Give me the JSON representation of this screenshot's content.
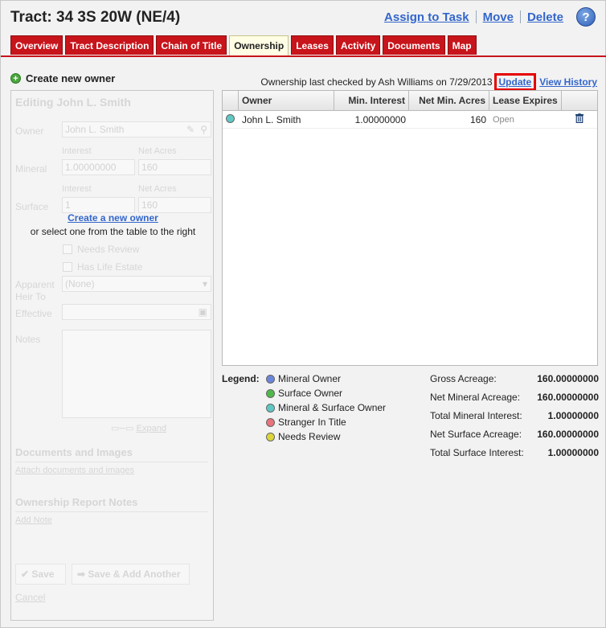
{
  "header": {
    "title": "Tract: 34 3S 20W (NE/4)",
    "links": [
      "Assign to Task",
      "Move",
      "Delete"
    ],
    "help_label": "?"
  },
  "tabs": [
    "Overview",
    "Tract Description",
    "Chain of Title",
    "Ownership",
    "Leases",
    "Activity",
    "Documents",
    "Map"
  ],
  "active_tab": "Ownership",
  "create_owner_label": "Create new owner",
  "editor": {
    "heading": "Editing John L. Smith",
    "owner_label": "Owner",
    "owner_value": "John L. Smith",
    "interest_header": "Interest",
    "net_acres_header": "Net Acres",
    "mineral_label": "Mineral",
    "mineral_interest": "1.00000000",
    "mineral_acres": "160",
    "surface_label": "Surface",
    "surface_interest": "1",
    "surface_acres": "160",
    "create_link": "Create a new owner",
    "select_hint": "or select one from the table to the right",
    "needs_review": "Needs Review",
    "has_life_estate": "Has Life Estate",
    "heir_label_1": "Apparent",
    "heir_label_2": "Heir To",
    "heir_value": "(None)",
    "effective_label": "Effective",
    "notes_label": "Notes",
    "expand_label": "Expand",
    "docs_heading": "Documents and Images",
    "attach_link": "Attach documents and images",
    "report_heading": "Ownership Report Notes",
    "add_note_link": "Add Note",
    "save_label": "Save",
    "save_add_label": "Save & Add Another",
    "cancel_label": "Cancel"
  },
  "status": {
    "text": "Ownership last checked by Ash Williams on 7/29/2013",
    "update_label": "Update",
    "history_label": "View History"
  },
  "table": {
    "columns": [
      "Owner",
      "Min. Interest",
      "Net Min. Acres",
      "Lease Expires"
    ],
    "rows": [
      {
        "owner": "John L. Smith",
        "min_interest": "1.00000000",
        "net_min_acres": "160",
        "lease_expires": "Open",
        "dot_color": "#5fc8c4"
      }
    ]
  },
  "legend": {
    "title": "Legend:",
    "items": [
      {
        "label": "Mineral Owner",
        "color": "#6b86d8"
      },
      {
        "label": "Surface Owner",
        "color": "#4fb84a"
      },
      {
        "label": "Mineral & Surface Owner",
        "color": "#5fc8c4"
      },
      {
        "label": "Stranger In Title",
        "color": "#e9737a"
      },
      {
        "label": "Needs Review",
        "color": "#dcd63a"
      }
    ]
  },
  "totals": [
    {
      "label": "Gross Acreage:",
      "value": "160.00000000"
    },
    {
      "label": "Net Mineral Acreage:",
      "value": "160.00000000"
    },
    {
      "label": "Total Mineral Interest:",
      "value": "1.00000000"
    },
    {
      "label": "Net Surface Acreage:",
      "value": "160.00000000"
    },
    {
      "label": "Total Surface Interest:",
      "value": "1.00000000"
    }
  ]
}
